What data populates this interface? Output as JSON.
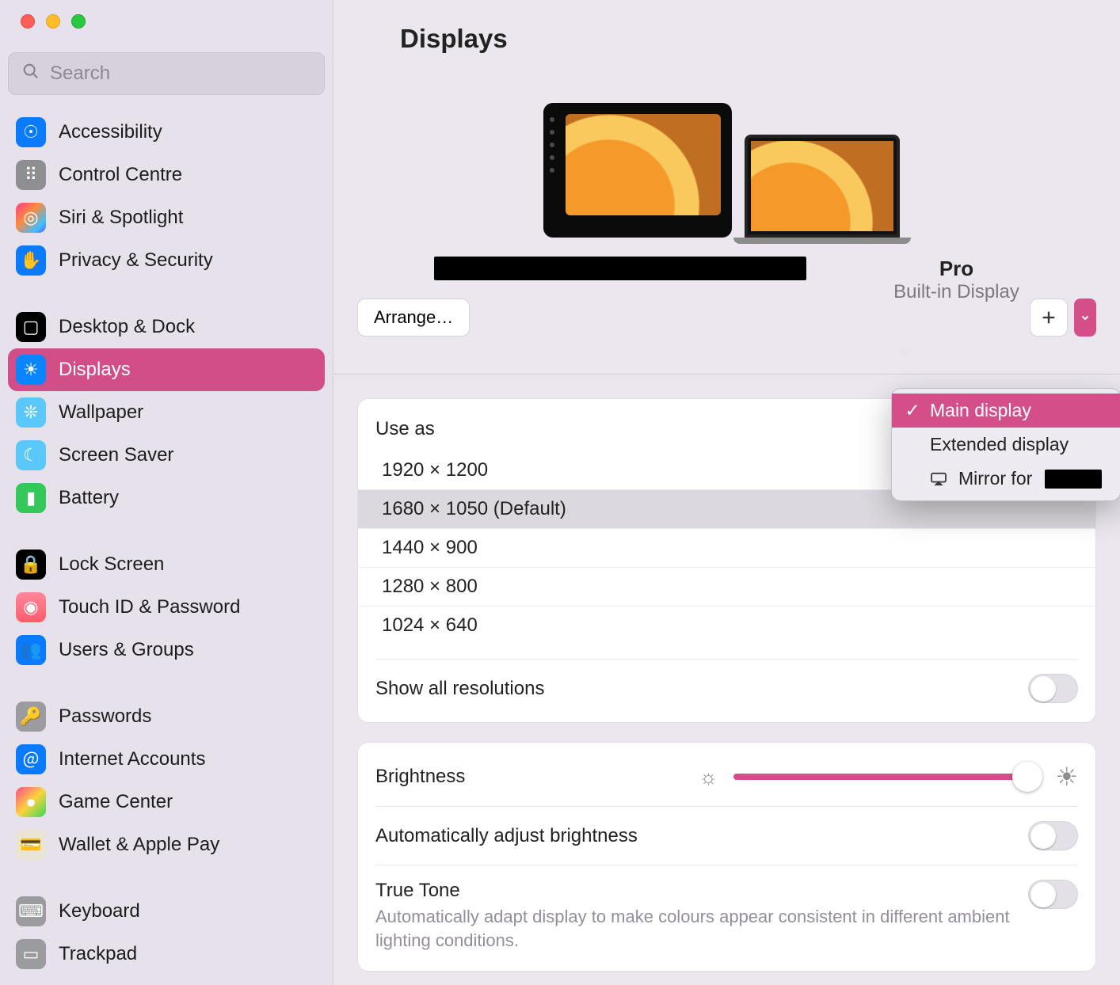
{
  "header": {
    "title": "Displays"
  },
  "search": {
    "placeholder": "Search"
  },
  "sidebar": {
    "groups": [
      {
        "items": [
          {
            "id": "accessibility",
            "label": "Accessibility",
            "iconClass": "ic-blue",
            "glyph": "☉"
          },
          {
            "id": "control-centre",
            "label": "Control Centre",
            "iconClass": "ic-gray",
            "glyph": "⠿"
          },
          {
            "id": "siri-spotlight",
            "label": "Siri & Spotlight",
            "iconClass": "ic-grad1",
            "glyph": "◎"
          },
          {
            "id": "privacy-security",
            "label": "Privacy & Security",
            "iconClass": "ic-blue",
            "glyph": "✋"
          }
        ]
      },
      {
        "items": [
          {
            "id": "desktop-dock",
            "label": "Desktop & Dock",
            "iconClass": "ic-black",
            "glyph": "▢"
          },
          {
            "id": "displays",
            "label": "Displays",
            "iconClass": "ic-blue",
            "glyph": "☀",
            "selected": true
          },
          {
            "id": "wallpaper",
            "label": "Wallpaper",
            "iconClass": "ic-cyan",
            "glyph": "❊"
          },
          {
            "id": "screen-saver",
            "label": "Screen Saver",
            "iconClass": "ic-cyan",
            "glyph": "☾"
          },
          {
            "id": "battery",
            "label": "Battery",
            "iconClass": "ic-green",
            "glyph": "▮"
          }
        ]
      },
      {
        "items": [
          {
            "id": "lock-screen",
            "label": "Lock Screen",
            "iconClass": "ic-black",
            "glyph": "🔒"
          },
          {
            "id": "touch-id",
            "label": "Touch ID & Password",
            "iconClass": "ic-rose",
            "glyph": "◉"
          },
          {
            "id": "users-groups",
            "label": "Users & Groups",
            "iconClass": "ic-blue",
            "glyph": "👥"
          }
        ]
      },
      {
        "items": [
          {
            "id": "passwords",
            "label": "Passwords",
            "iconClass": "ic-gray2",
            "glyph": "🔑"
          },
          {
            "id": "internet-accounts",
            "label": "Internet Accounts",
            "iconClass": "ic-blue",
            "glyph": "＠"
          },
          {
            "id": "game-center",
            "label": "Game Center",
            "iconClass": "ic-multi",
            "glyph": "●"
          },
          {
            "id": "wallet-apple-pay",
            "label": "Wallet & Apple Pay",
            "iconClass": "ic-light",
            "glyph": "💳"
          }
        ]
      },
      {
        "items": [
          {
            "id": "keyboard",
            "label": "Keyboard",
            "iconClass": "ic-gray2",
            "glyph": "⌨"
          },
          {
            "id": "trackpad",
            "label": "Trackpad",
            "iconClass": "ic-gray2",
            "glyph": "▭"
          }
        ]
      }
    ]
  },
  "displaySection": {
    "arrangeLabel": "Arrange…",
    "selectedDisplay": {
      "name": "Pro",
      "subtitle": "Built-in Display"
    }
  },
  "useAs": {
    "label": "Use as",
    "options": [
      {
        "label": "Main display",
        "selected": true
      },
      {
        "label": "Extended display"
      },
      {
        "label": "Mirror for",
        "mirror": true
      }
    ]
  },
  "resolutions": {
    "items": [
      {
        "label": "1920 × 1200"
      },
      {
        "label": "1680 × 1050 (Default)",
        "selected": true
      },
      {
        "label": "1440 × 900"
      },
      {
        "label": "1280 × 800"
      },
      {
        "label": "1024 × 640"
      }
    ],
    "showAllLabel": "Show all resolutions",
    "showAllOn": false
  },
  "brightness": {
    "label": "Brightness",
    "percent": 96,
    "autoLabel": "Automatically adjust brightness",
    "autoOn": false,
    "trueToneLabel": "True Tone",
    "trueToneDesc": "Automatically adapt display to make colours appear consistent in different ambient lighting conditions.",
    "trueToneOn": false
  }
}
